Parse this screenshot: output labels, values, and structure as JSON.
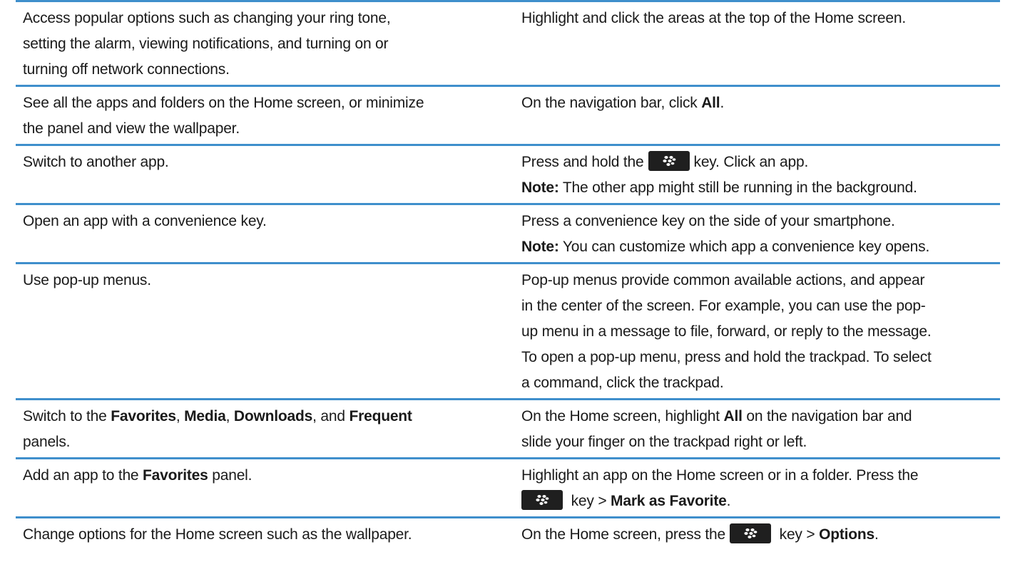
{
  "rows": [
    {
      "task": [
        "Access popular options such as changing your ring tone,",
        "setting the alarm, viewing notifications, and turning on or",
        "turning off network connections."
      ],
      "instruction": "Highlight and click the areas at the top of the Home screen."
    },
    {
      "task": [
        "See all the apps and folders on the Home screen, or minimize",
        "the panel and view the wallpaper."
      ],
      "instruction_pre": "On the navigation bar, click ",
      "instruction_bold": "All",
      "instruction_post": "."
    },
    {
      "task": [
        "Switch to another app."
      ],
      "instruction_pre": "Press and hold the",
      "instruction_post": "key. Click an app.",
      "note_label": "Note:",
      "note_text": " The other app might still be running in the background."
    },
    {
      "task": [
        "Open an app with a convenience key."
      ],
      "instruction": "Press a convenience key on the side of your smartphone.",
      "note_label": "Note:",
      "note_text": " You can customize which app a convenience key opens."
    },
    {
      "task": [
        "Use pop-up menus."
      ],
      "instruction_lines": [
        "Pop-up menus provide common available actions, and appear",
        "in the center of the screen. For example, you can use the pop-",
        "up menu in a message to file, forward, or reply to the message.",
        "To open a pop-up menu, press and hold the trackpad. To select",
        "a command, click the trackpad."
      ]
    },
    {
      "task_parts": [
        "Switch to the ",
        "Favorites",
        ", ",
        "Media",
        ", ",
        "Downloads",
        ", and ",
        "Frequent"
      ],
      "task_line2": "panels.",
      "instruction_pre": "On the Home screen, highlight ",
      "instruction_bold": "All",
      "instruction_post": " on the navigation bar and",
      "instruction_line2": "slide your finger on the trackpad right or left."
    },
    {
      "task_pre": "Add an app to the ",
      "task_bold": "Favorites",
      "task_post": " panel.",
      "instruction": "Highlight an app on the Home screen or in a folder. Press the",
      "instruction_line2_post": " key > ",
      "instruction_line2_bold": "Mark as Favorite",
      "instruction_line2_end": "."
    },
    {
      "task": [
        "Change options for the Home screen such as the wallpaper."
      ],
      "instruction_pre": "On the Home screen, press the",
      "instruction_post": " key > ",
      "instruction_bold": "Options",
      "instruction_end": "."
    }
  ],
  "key_icon": "blackberry-menu-key-icon",
  "colors": {
    "rule": "#3f8fcc",
    "key": "#1f1f1f"
  }
}
